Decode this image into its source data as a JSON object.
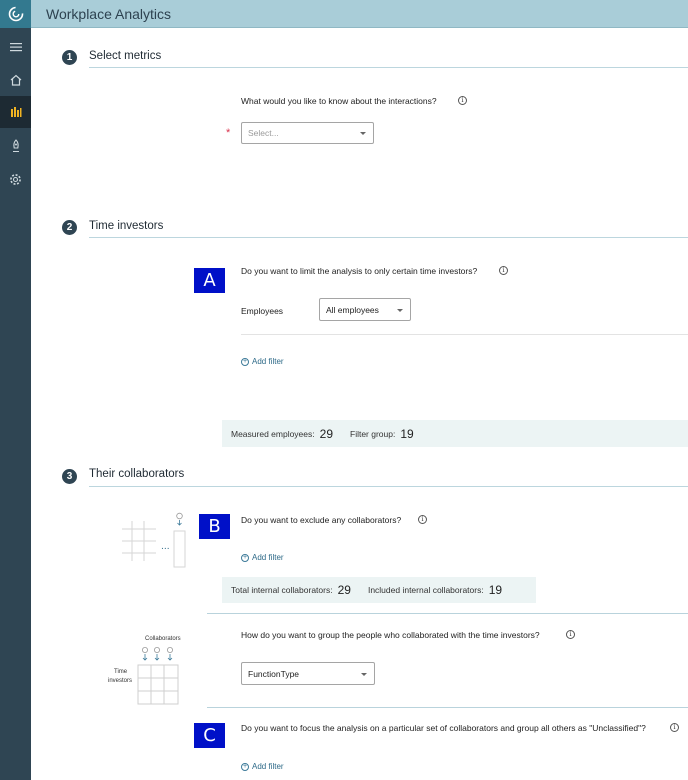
{
  "app": {
    "title": "Workplace Analytics"
  },
  "nav": [
    "logo-icon",
    "menu-icon",
    "home-icon",
    "analysis-icon",
    "rocket-icon",
    "settings-icon"
  ],
  "step1": {
    "number": "1",
    "title": "Select metrics",
    "question": "What would you like to know about the interactions?",
    "required_mark": "*",
    "select_placeholder": "Select..."
  },
  "step2": {
    "number": "2",
    "title": "Time investors",
    "marker": "A",
    "question": "Do you want to limit the analysis to only certain time investors?",
    "employees_label": "Employees",
    "employees_value": "All employees",
    "add_filter": "Add filter",
    "measured_label": "Measured employees:",
    "measured_value": "29",
    "filter_group_label": "Filter group:",
    "filter_group_value": "19"
  },
  "step3": {
    "number": "3",
    "title": "Their collaborators",
    "marker_b": "B",
    "question_b": "Do you want to exclude any collaborators?",
    "add_filter_b": "Add filter",
    "total_label": "Total internal collaborators:",
    "total_value": "29",
    "included_label": "Included internal collaborators:",
    "included_value": "19",
    "collab_illustration_label": "Collaborators",
    "time_investors_label_1": "Time",
    "time_investors_label_2": "investors",
    "question_group": "How do you want to group the people who collaborated with the time investors?",
    "group_value": "FunctionType",
    "marker_c": "C",
    "question_c": "Do you want to focus the analysis on a particular set of collaborators and group all others as \"Unclassified\"?",
    "add_filter_c": "Add filter"
  },
  "colors": {
    "rail": "#2f4553",
    "header": "#a9cdd8",
    "marker": "#0010c8",
    "stats_bg": "#ecf4f4"
  }
}
